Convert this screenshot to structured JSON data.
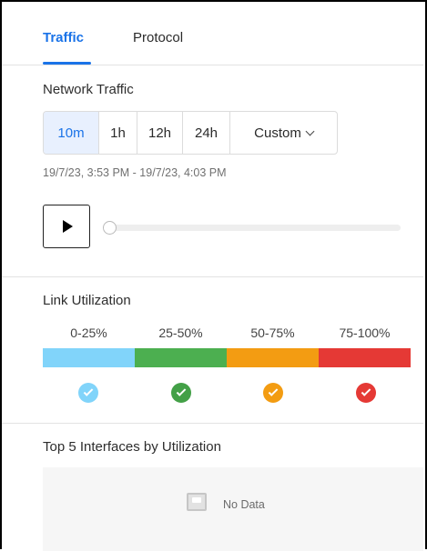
{
  "tabs": [
    {
      "label": "Traffic",
      "active": true
    },
    {
      "label": "Protocol",
      "active": false
    }
  ],
  "network_traffic": {
    "title": "Network Traffic",
    "ranges": [
      "10m",
      "1h",
      "12h",
      "24h",
      "Custom"
    ],
    "selected_range": "10m",
    "time_range_text": "19/7/23, 3:53 PM - 19/7/23, 4:03 PM",
    "playback_position": 0
  },
  "link_utilization": {
    "title": "Link Utilization",
    "buckets": [
      {
        "label": "0-25%",
        "color": "#81d4fa",
        "check_color": "#81d4fa"
      },
      {
        "label": "25-50%",
        "color": "#4caf50",
        "check_color": "#43a047"
      },
      {
        "label": "50-75%",
        "color": "#f39c12",
        "check_color": "#f39c12"
      },
      {
        "label": "75-100%",
        "color": "#e53935",
        "check_color": "#e53935"
      }
    ]
  },
  "top_interfaces": {
    "title": "Top 5 Interfaces by Utilization",
    "empty_text": "No Data"
  },
  "colors": {
    "accent": "#1a73e8",
    "selected_bg": "#e8f0fe"
  },
  "icons": {
    "play": "play-icon",
    "chevron": "chevron-down-icon",
    "check": "check-circle-icon",
    "no_data": "no-data-icon"
  }
}
